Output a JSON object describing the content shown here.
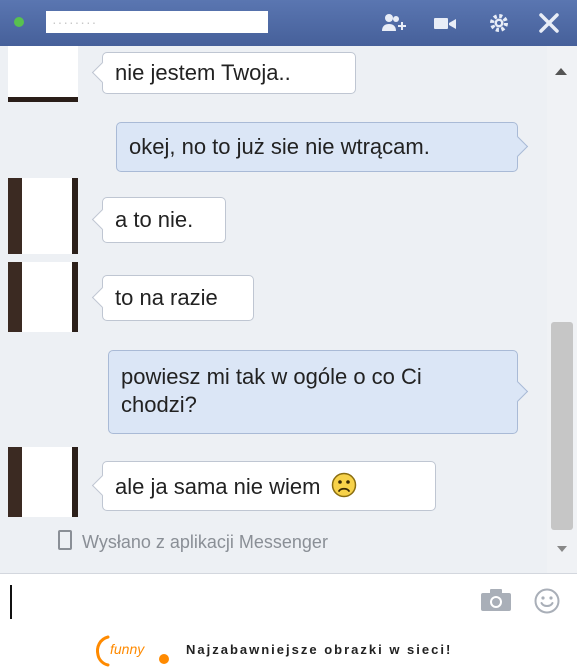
{
  "header": {
    "contact_name": "········",
    "icons": [
      "add-friend-icon",
      "video-call-icon",
      "gear-icon",
      "close-icon"
    ]
  },
  "messages": [
    {
      "side": "in",
      "text": "nie jestem Twoja.."
    },
    {
      "side": "out",
      "text": "okej, no to już sie nie wtrącam."
    },
    {
      "side": "in",
      "text": "a to nie."
    },
    {
      "side": "in",
      "text": "to na razie"
    },
    {
      "side": "out",
      "text": "powiesz mi tak w ogóle o co Ci chodzi?"
    },
    {
      "side": "in",
      "text": "ale ja sama nie wiem"
    }
  ],
  "sent_via": "Wysłano z aplikacji Messenger",
  "input": {
    "value": ""
  },
  "footer": {
    "logo_text": "funny",
    "tagline": "Najzabawniejsze obrazki w sieci!"
  },
  "colors": {
    "header": "#4c68a4",
    "online": "#58c14f",
    "bubble_out": "#dbe6f6",
    "brand_orange": "#ff8a00"
  }
}
